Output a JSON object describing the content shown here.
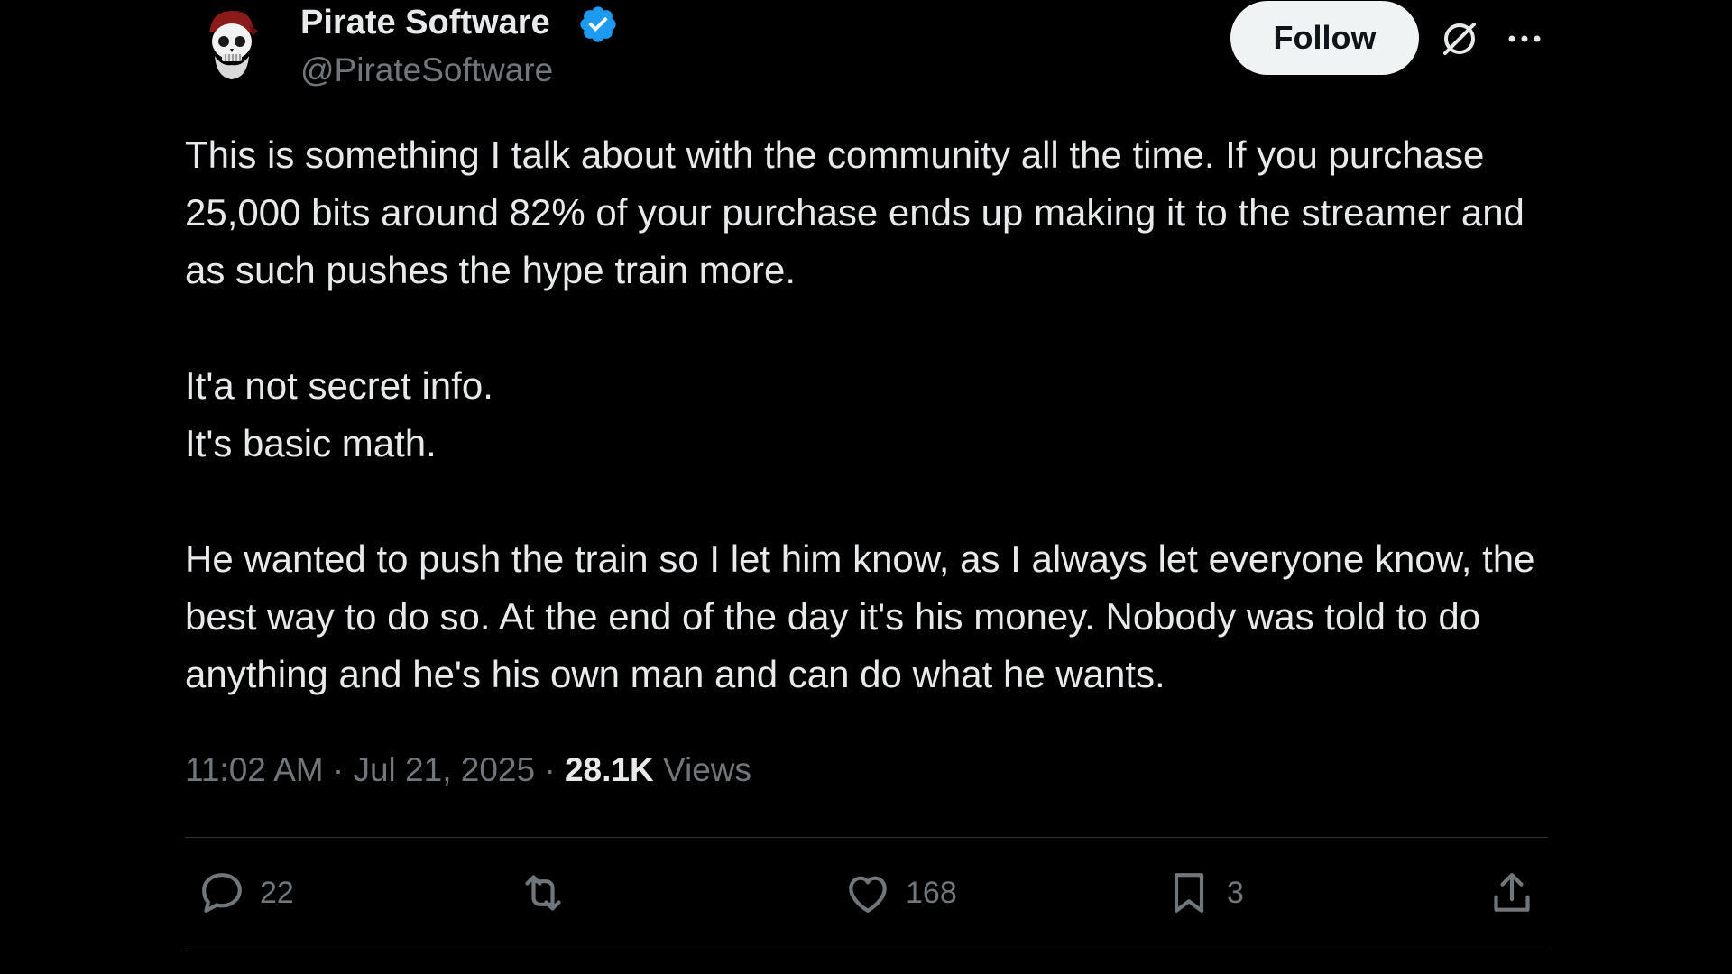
{
  "author": {
    "display_name": "Pirate Software",
    "handle": "@PirateSoftware",
    "verified_icon": "verified-badge-icon",
    "avatar_icon": "pirate-skull-avatar"
  },
  "header_actions": {
    "follow_label": "Follow",
    "grok_icon": "grok-icon",
    "more_icon": "more-icon"
  },
  "tweet": {
    "paragraphs": [
      "This is something I talk about with the community all the time. If you purchase 25,000 bits around 82% of your purchase ends up making it to the streamer and as such pushes the hype train more.",
      "It'a not secret info.",
      "It's basic math.",
      "He wanted to push the train so I let him know, as I always let everyone know, the best way to do so. At the end of the day it's his money. Nobody was told to do anything and he's his own man and can do what he wants."
    ]
  },
  "meta": {
    "time": "11:02 AM",
    "separator": "·",
    "date": "Jul 21, 2025",
    "views_count": "28.1K",
    "views_label": "Views"
  },
  "actions": {
    "replies": "22",
    "reposts": "",
    "likes": "168",
    "bookmarks": "3"
  },
  "colors": {
    "background": "#000000",
    "text": "#e7e9ea",
    "secondary_text": "#71767b",
    "verified_blue": "#1d9bf0",
    "follow_button_bg": "#eff3f4",
    "divider": "#2f3336"
  }
}
